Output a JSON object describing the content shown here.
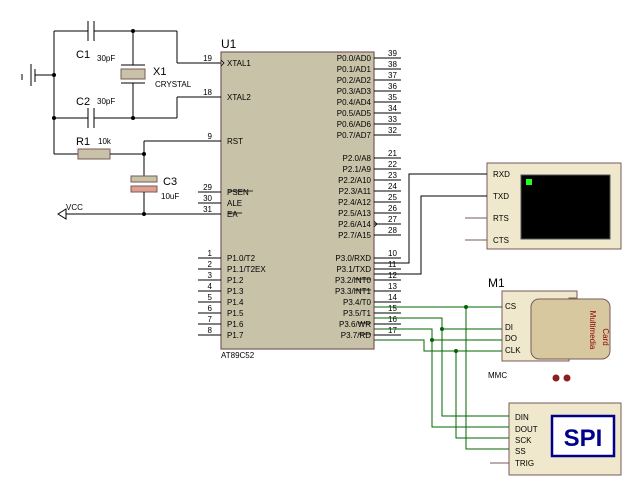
{
  "u1": {
    "ref": "U1",
    "part": "AT89C52",
    "left_pins": [
      {
        "num": "19",
        "name": "XTAL1"
      },
      {
        "num": "18",
        "name": "XTAL2"
      },
      {
        "num": "9",
        "name": "RST"
      },
      {
        "num": "29",
        "name": "PSEN"
      },
      {
        "num": "30",
        "name": "ALE"
      },
      {
        "num": "31",
        "name": "EA"
      },
      {
        "num": "1",
        "name": "P1.0/T2"
      },
      {
        "num": "2",
        "name": "P1.1/T2EX"
      },
      {
        "num": "3",
        "name": "P1.2"
      },
      {
        "num": "4",
        "name": "P1.3"
      },
      {
        "num": "5",
        "name": "P1.4"
      },
      {
        "num": "6",
        "name": "P1.5"
      },
      {
        "num": "7",
        "name": "P1.6"
      },
      {
        "num": "8",
        "name": "P1.7"
      }
    ],
    "right_pins": [
      {
        "num": "39",
        "name": "P0.0/AD0"
      },
      {
        "num": "38",
        "name": "P0.1/AD1"
      },
      {
        "num": "37",
        "name": "P0.2/AD2"
      },
      {
        "num": "36",
        "name": "P0.3/AD3"
      },
      {
        "num": "35",
        "name": "P0.4/AD4"
      },
      {
        "num": "34",
        "name": "P0.5/AD5"
      },
      {
        "num": "33",
        "name": "P0.6/AD6"
      },
      {
        "num": "32",
        "name": "P0.7/AD7"
      },
      {
        "num": "21",
        "name": "P2.0/A8"
      },
      {
        "num": "22",
        "name": "P2.1/A9"
      },
      {
        "num": "23",
        "name": "P2.2/A10"
      },
      {
        "num": "24",
        "name": "P2.3/A11"
      },
      {
        "num": "25",
        "name": "P2.4/A12"
      },
      {
        "num": "26",
        "name": "P2.5/A13"
      },
      {
        "num": "27",
        "name": "P2.6/A14"
      },
      {
        "num": "28",
        "name": "P2.7/A15"
      },
      {
        "num": "10",
        "name": "P3.0/RXD"
      },
      {
        "num": "11",
        "name": "P3.1/TXD"
      },
      {
        "num": "12",
        "name": "P3.2/INT0"
      },
      {
        "num": "13",
        "name": "P3.3/INT1"
      },
      {
        "num": "14",
        "name": "P3.4/T0"
      },
      {
        "num": "15",
        "name": "P3.5/T1"
      },
      {
        "num": "16",
        "name": "P3.6/WR"
      },
      {
        "num": "17",
        "name": "P3.7/RD"
      }
    ]
  },
  "c1": {
    "ref": "C1",
    "value": "30pF"
  },
  "c2": {
    "ref": "C2",
    "value": "30pF"
  },
  "x1": {
    "ref": "X1",
    "value": "CRYSTAL"
  },
  "r1": {
    "ref": "R1",
    "value": "10k"
  },
  "c3": {
    "ref": "C3",
    "value": "10uF"
  },
  "vcc": {
    "label": "VCC"
  },
  "terminal": {
    "pins": [
      "RXD",
      "TXD",
      "RTS",
      "CTS"
    ]
  },
  "m1": {
    "ref": "M1",
    "part": "MMC",
    "card_text_1": "Card",
    "card_text_2": "Multimedia",
    "pins": [
      "CS",
      "DI",
      "DO",
      "CLK"
    ]
  },
  "spi": {
    "label": "SPI",
    "pins": [
      "DIN",
      "DOUT",
      "SCK",
      "SS",
      "TRIG"
    ]
  },
  "colors": {
    "chip_fill": "#c8c2a8",
    "panel_fill": "#f0e8cc",
    "wire_green": "#006400",
    "screen": "#000000",
    "spi_text": "#00008b"
  }
}
